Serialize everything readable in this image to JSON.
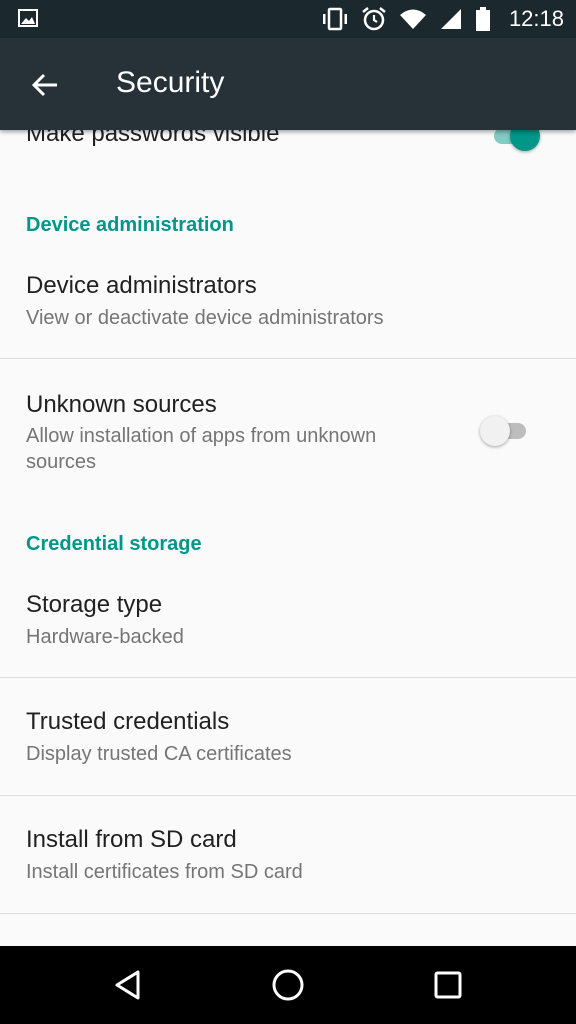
{
  "status_bar": {
    "time": "12:18",
    "icons": [
      "image-notification-icon",
      "vibrate-icon",
      "alarm-icon",
      "wifi-icon",
      "signal-icon",
      "battery-icon"
    ]
  },
  "app_bar": {
    "title": "Security",
    "back_icon": "arrow-back-icon"
  },
  "settings": {
    "make_passwords_visible": {
      "title": "Make passwords visible",
      "enabled": true
    },
    "device_administration_header": "Device administration",
    "device_administrators": {
      "title": "Device administrators",
      "summary": "View or deactivate device administrators"
    },
    "unknown_sources": {
      "title": "Unknown sources",
      "summary_line1": "Allow installation of apps from unknown",
      "summary_line2": "sources",
      "enabled": false
    },
    "credential_storage_header": "Credential storage",
    "storage_type": {
      "title": "Storage type",
      "summary": "Hardware-backed"
    },
    "trusted_credentials": {
      "title": "Trusted credentials",
      "summary": "Display trusted CA certificates"
    },
    "install_from_sd": {
      "title": "Install from SD card",
      "summary": "Install certificates from SD card"
    }
  },
  "nav_bar": {
    "icons": [
      "back-triangle-icon",
      "home-circle-icon",
      "recents-square-icon"
    ]
  },
  "colors": {
    "accent": "#009688",
    "app_bar": "#263238",
    "status_bar": "#1b282e",
    "background": "#fafafa"
  }
}
